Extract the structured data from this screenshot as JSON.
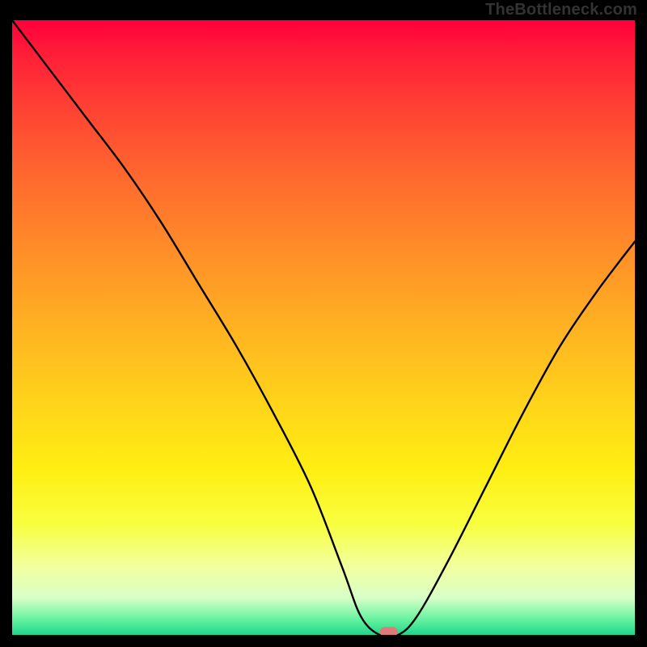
{
  "watermark": "TheBottleneck.com",
  "chart_data": {
    "type": "line",
    "title": "",
    "xlabel": "",
    "ylabel": "",
    "xlim": [
      0,
      100
    ],
    "ylim": [
      0,
      100
    ],
    "grid": false,
    "legend": false,
    "series": [
      {
        "name": "bottleneck-curve",
        "x": [
          0,
          6,
          12,
          18,
          24,
          30,
          36,
          42,
          48,
          53,
          56,
          59,
          62,
          65,
          70,
          76,
          82,
          88,
          94,
          100
        ],
        "y": [
          100,
          92,
          84,
          76,
          67,
          57,
          47,
          36,
          24,
          11,
          3,
          0,
          0,
          3,
          12,
          24,
          36,
          47,
          56,
          64
        ]
      }
    ],
    "marker": {
      "x": 60.5,
      "y": 0.5,
      "color": "#e07a7a",
      "shape": "rounded-rect"
    },
    "background_gradient": {
      "stops": [
        {
          "pos": 0.0,
          "color": "#ff003a"
        },
        {
          "pos": 0.5,
          "color": "#ffb222"
        },
        {
          "pos": 0.82,
          "color": "#f8ff40"
        },
        {
          "pos": 1.0,
          "color": "#1ed78c"
        }
      ]
    }
  }
}
